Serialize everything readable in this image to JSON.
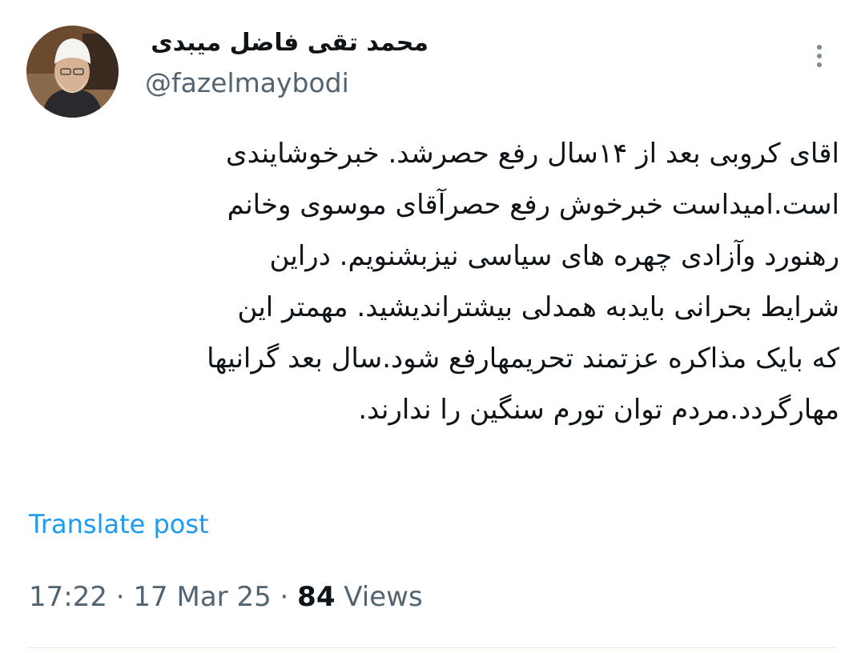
{
  "author": {
    "display_name": "محمد تقی فاضل میبدی",
    "handle": "@fazelmaybodi"
  },
  "more_icon": "more-vertical-icon",
  "post": {
    "lines": [
      "اقای کروبی بعد از ۱۴سال رفع حصرشد. خبرخوشایندی",
      "است.امیداست خبرخوش رفع حصرآقای موسوی وخانم",
      "رهنورد وآزادی چهره های سیاسی نیزبشنویم. دراین",
      "شرایط بحرانی بایدبه همدلی بیشتراندیشید. مهمتر این",
      "که بایک مذاکره عزتمند  تحریمهارفع شود.سال بعد گرانیها",
      "مهارگردد.مردم توان تورم سنگین را ندارند."
    ]
  },
  "translate_label": "Translate post",
  "meta": {
    "time": "17:22",
    "separator": "·",
    "date": "17 Mar 25",
    "views_count": "84",
    "views_label": "Views"
  },
  "colors": {
    "link": "#1d9bf0",
    "secondary_text": "#536471",
    "primary_text": "#0f1419"
  }
}
